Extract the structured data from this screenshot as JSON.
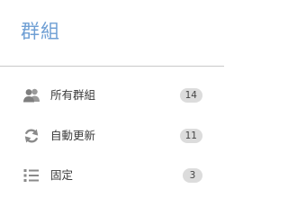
{
  "header": {
    "title": "群組"
  },
  "colors": {
    "title": "#6f9fd4",
    "icon": "#8a8a8a",
    "badge_bg": "#dcdcdc",
    "text": "#3a3a3a",
    "divider": "#c9c9c9"
  },
  "groups": [
    {
      "icon": "people-icon",
      "label": "所有群組",
      "count": "14"
    },
    {
      "icon": "sync-icon",
      "label": "自動更新",
      "count": "11"
    },
    {
      "icon": "list-icon",
      "label": "固定",
      "count": "3"
    }
  ]
}
